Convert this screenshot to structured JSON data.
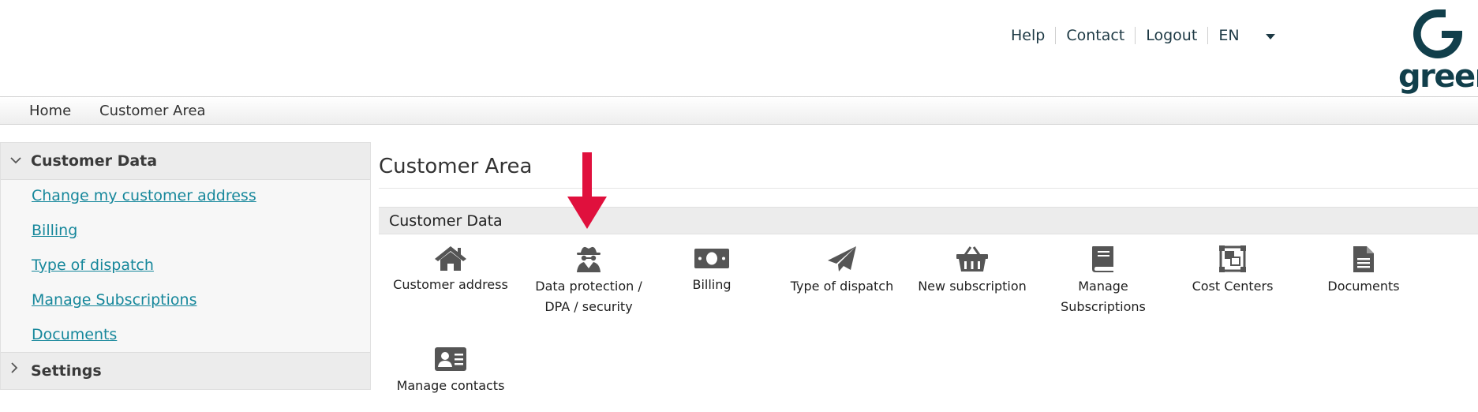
{
  "header": {
    "nav": [
      "Help",
      "Contact",
      "Logout"
    ],
    "language": "EN",
    "logo_text": "green"
  },
  "breadcrumb": [
    "Home",
    "Customer Area"
  ],
  "sidebar": {
    "section_title": "Customer Data",
    "links": [
      "Change my customer address",
      "Billing",
      "Type of dispatch",
      "Manage Subscriptions",
      "Documents"
    ],
    "settings_title": "Settings"
  },
  "main": {
    "title": "Customer Area",
    "section": "Customer Data",
    "tiles": [
      {
        "label": "Customer address",
        "icon": "home-icon"
      },
      {
        "label": "Data protection / DPA / security",
        "icon": "spy-icon"
      },
      {
        "label": "Billing",
        "icon": "money-bill-icon"
      },
      {
        "label": "Type of dispatch",
        "icon": "paper-plane-icon"
      },
      {
        "label": "New subscription",
        "icon": "basket-icon"
      },
      {
        "label": "Manage Subscriptions",
        "icon": "book-icon"
      },
      {
        "label": "Cost Centers",
        "icon": "object-group-icon"
      },
      {
        "label": "Documents",
        "icon": "file-icon"
      },
      {
        "label": "Manage contacts",
        "icon": "id-card-icon"
      }
    ]
  },
  "colors": {
    "brand": "#113f4b",
    "link": "#16879b",
    "icon": "#555555",
    "arrow": "#e0103d"
  }
}
